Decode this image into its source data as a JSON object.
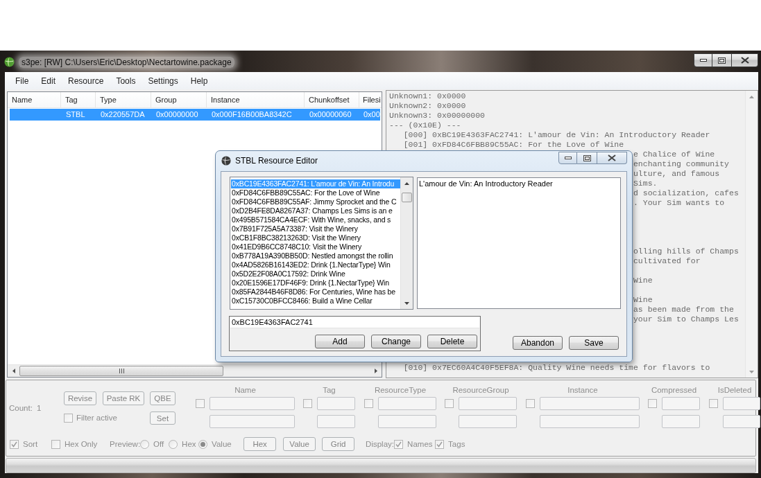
{
  "window": {
    "title": "s3pe: [RW] C:\\Users\\Eric\\Desktop\\Nectartowine.package"
  },
  "menu": [
    {
      "label": "File"
    },
    {
      "label": "Edit"
    },
    {
      "label": "Resource"
    },
    {
      "label": "Tools"
    },
    {
      "label": "Settings"
    },
    {
      "label": "Help"
    }
  ],
  "resource_list": {
    "columns": [
      "Name",
      "Tag",
      "Type",
      "Group",
      "Instance",
      "Chunkoffset",
      "Filesi"
    ],
    "rows": [
      {
        "selected": true,
        "cells": [
          "",
          "STBL",
          "0x220557DA",
          "0x00000000",
          "0x000F16B00BA8342C",
          "0x00000060",
          "0x00"
        ]
      }
    ]
  },
  "preview": {
    "lines": [
      {
        "kind": "header",
        "text": "Unknown1: 0x0000"
      },
      {
        "kind": "header",
        "text": "Unknown2: 0x0000"
      },
      {
        "kind": "header",
        "text": "Unknown3: 0x00000000"
      },
      {
        "kind": "header",
        "text": "--- (0x10E) ---"
      },
      {
        "kind": "entry",
        "text": "[000] 0xBC19E4363FAC2741: L'amour de Vin: An Introductory Reader"
      },
      {
        "kind": "entry",
        "text": "[001] 0xFD84C6FBB89C55AC: For the Love of Wine"
      },
      {
        "kind": "clipped",
        "text": "e Chalice of Wine"
      },
      {
        "kind": "clipped",
        "text": "enchanting community"
      },
      {
        "kind": "clipped",
        "text": "ulture, and famous"
      },
      {
        "kind": "clipped",
        "text": "Sims."
      },
      {
        "kind": "clipped",
        "text": "d socialization, cafes"
      },
      {
        "kind": "clipped",
        "text": ". Your Sim wants to"
      },
      {
        "kind": "covered"
      },
      {
        "kind": "covered"
      },
      {
        "kind": "covered"
      },
      {
        "kind": "covered"
      },
      {
        "kind": "clipped",
        "text": "olling hills of Champs"
      },
      {
        "kind": "clipped",
        "text": "cultivated for"
      },
      {
        "kind": "covered"
      },
      {
        "kind": "clipped",
        "text": "Wine"
      },
      {
        "kind": "covered"
      },
      {
        "kind": "clipped",
        "text": "Wine"
      },
      {
        "kind": "clipped",
        "text": "as been made from the"
      },
      {
        "kind": "clipped",
        "text": "your Sim to Champs Les"
      },
      {
        "kind": "covered"
      },
      {
        "kind": "covered"
      },
      {
        "kind": "covered"
      },
      {
        "kind": "covered"
      },
      {
        "kind": "entry",
        "text": "[010] 0x7EC60A4C40F5EF8A: Quality Wine needs time for flavors to"
      }
    ]
  },
  "dialog": {
    "title": "STBL Resource Editor",
    "strings": [
      {
        "text": "0xBC19E4363FAC2741: L'amour de Vin: An Introdu",
        "selected": true
      },
      {
        "text": "0xFD84C6FBB89C55AC: For the Love of Wine",
        "selected": false
      },
      {
        "text": "0xFD84C6FBB89C55AF: Jimmy Sprocket and the C",
        "selected": false
      },
      {
        "text": "0xD2B4FE8DA8267A37: Champs Les Sims is an e",
        "selected": false
      },
      {
        "text": "0x495B571584CA4ECF: With Wine, snacks, and s",
        "selected": false
      },
      {
        "text": "0x7B91F725A5A73387: Visit the Winery",
        "selected": false
      },
      {
        "text": "0xCB1F8BC38213263D: Visit the Winery",
        "selected": false
      },
      {
        "text": "0x41ED9B6CC8748C10: Visit the Winery",
        "selected": false
      },
      {
        "text": "0xB778A19A390BB50D: Nestled amongst the rollin",
        "selected": false
      },
      {
        "text": "0x4AD5826B16143ED2: Drink {1.NectarType} Win",
        "selected": false
      },
      {
        "text": "0x5D2E2F08A0C17592: Drink Wine",
        "selected": false
      },
      {
        "text": "0x20E1596E17DF46F9: Drink {1.NectarType} Win",
        "selected": false
      },
      {
        "text": "0x85FA2844B46F8D86: For Centuries, Wine has be",
        "selected": false
      },
      {
        "text": "0xC15730C0BFCC8466: Build a Wine Cellar",
        "selected": false
      }
    ],
    "value": "L'amour de Vin: An Introductory Reader",
    "key_field": {
      "value": "0xBC19E4363FAC2741"
    },
    "edit_buttons": [
      {
        "label": "Add"
      },
      {
        "label": "Change"
      },
      {
        "label": "Delete"
      }
    ],
    "buttons": [
      {
        "label": "Abandon"
      },
      {
        "label": "Save"
      }
    ]
  },
  "filter": {
    "disabled": true,
    "count_label": "Count:",
    "count": "1",
    "buttons": [
      {
        "label": "Revise"
      },
      {
        "label": "Paste RK"
      },
      {
        "label": "QBE"
      }
    ],
    "filter_active": {
      "label": "Filter active",
      "checked": false
    },
    "set_button": {
      "label": "Set"
    },
    "columns": [
      {
        "label": "Name",
        "checked": false
      },
      {
        "label": "Tag",
        "checked": false
      },
      {
        "label": "ResourceType",
        "checked": false
      },
      {
        "label": "ResourceGroup",
        "checked": false
      },
      {
        "label": "Instance",
        "checked": false
      },
      {
        "label": "Compressed",
        "checked": false
      },
      {
        "label": "IsDeleted",
        "checked": false
      }
    ],
    "sort": {
      "label": "Sort",
      "checked": true
    },
    "hex_only": {
      "label": "Hex Only",
      "checked": false
    },
    "preview_label": "Preview:",
    "preview_modes": [
      {
        "label": "Off",
        "selected": false
      },
      {
        "label": "Hex",
        "selected": false
      },
      {
        "label": "Value",
        "selected": true
      }
    ],
    "view_buttons": [
      {
        "label": "Hex"
      },
      {
        "label": "Value"
      },
      {
        "label": "Grid"
      }
    ],
    "display_label": "Display:",
    "display": [
      {
        "label": "Names",
        "checked": true
      },
      {
        "label": "Tags",
        "checked": true
      }
    ]
  }
}
